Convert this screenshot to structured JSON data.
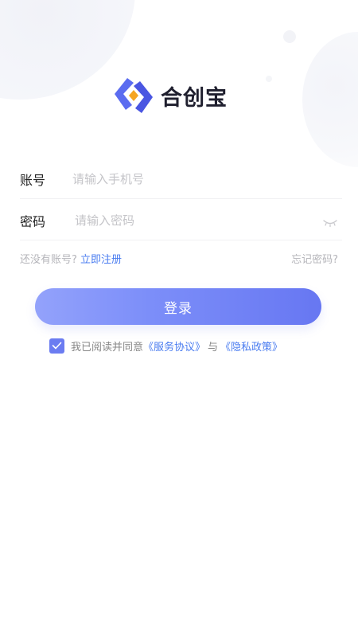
{
  "app": {
    "name": "合创宝"
  },
  "form": {
    "account_label": "账号",
    "account_placeholder": "请输入手机号",
    "password_label": "密码",
    "password_placeholder": "请输入密码"
  },
  "links": {
    "no_account": "还没有账号?",
    "register": "立即注册",
    "forgot": "忘记密码?"
  },
  "login_button": "登录",
  "agreement": {
    "checked": true,
    "prefix": "我已阅读并同意",
    "service": "《服务协议》",
    "connector": "与",
    "privacy": "《隐私政策》"
  },
  "colors": {
    "accent": "#6b7cf1",
    "link": "#4a7cf0",
    "logo_blue": "#5b6cf0",
    "logo_orange": "#f5a524"
  },
  "icons": {
    "logo": "hechuangbao-logo-icon",
    "password_toggle": "eye-closed-icon",
    "checkbox": "check-icon"
  }
}
